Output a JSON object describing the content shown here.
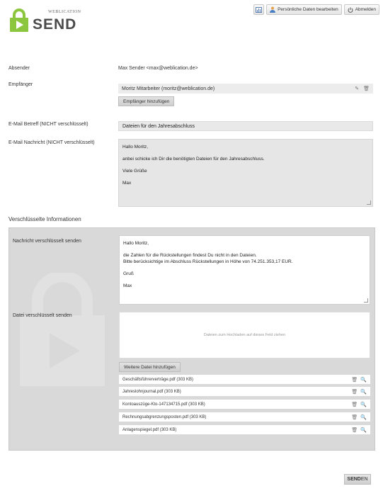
{
  "brand": {
    "small_label": "WEBLICATION",
    "product": "SEND",
    "color": "#8cc63f"
  },
  "top_buttons": {
    "chart_icon": "chart-icon",
    "edit_profile": "Persönliche Daten bearbeiten",
    "logout": "Abmelden"
  },
  "form": {
    "sender_label": "Absender",
    "sender_value": "Max Sender <max@weblication.de>",
    "recipient_label": "Empfänger",
    "recipients": [
      {
        "name": "Moritz Mitarbeiter  (moritz@weblication.de)"
      }
    ],
    "add_recipient": "Empfänger hinzufügen",
    "subject_label": "E-Mail Betreff (NICHT verschlüsselt)",
    "subject_value": "Dateien für den Jahresabschluss",
    "message_label": "E-Mail Nachricht (NICHT verschlüsselt)",
    "message_lines": [
      "Hallo Moritz,",
      "anbei schicke ich Dir die benötigten Dateien für den Jahresabschluss.",
      "Viele Grüße",
      "Max"
    ]
  },
  "encrypted": {
    "section_title": "Verschlüsselte Informationen",
    "message_label": "Nachricht verschlüsselt senden",
    "message_lines": [
      "Hallo Moritz,",
      "die Zahlen für die Rückstellungen findest Du nicht in den Dateien.",
      "Bitte berücksichtige im Abschluss Rückstellungen in Höhe von 74.251.353,17 EUR.",
      "Gruß",
      "Max"
    ],
    "file_label": "Datei verschlüsselt senden",
    "dropzone_text": "Dateien zum Hochladen auf dieses Feld ziehen",
    "add_file": "Weitere Datei hinzufügen",
    "files": [
      "Geschäftsführerverträge.pdf (303 KB)",
      "Jahreslohnjournal.pdf (303 KB)",
      "Kontoauszüge-Kto-147134715.pdf (303 KB)",
      "Rechnungsabgrenzungsposten.pdf (303 KB)",
      "Anlagenspiegel.pdf (303 KB)"
    ]
  },
  "send_button": {
    "bold": "SEND",
    "rest": "EN"
  }
}
